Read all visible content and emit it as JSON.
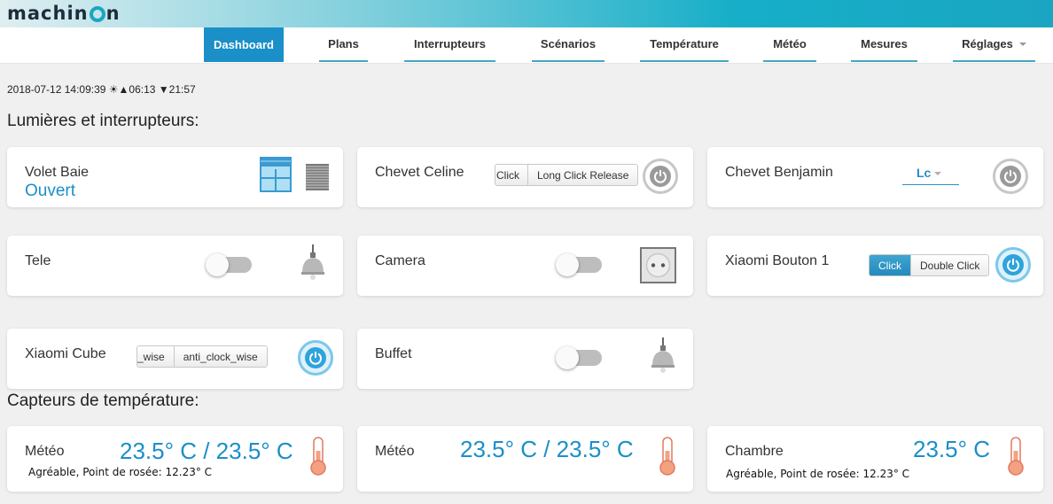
{
  "app": {
    "logo_text": "machinon"
  },
  "nav": {
    "items": [
      {
        "label": "Dashboard",
        "active": true
      },
      {
        "label": "Plans"
      },
      {
        "label": "Interrupteurs"
      },
      {
        "label": "Scénarios"
      },
      {
        "label": "Température"
      },
      {
        "label": "Météo"
      },
      {
        "label": "Mesures"
      },
      {
        "label": "Réglages",
        "has_caret": true
      }
    ]
  },
  "status_bar": {
    "datetime": "2018-07-12 14:09:39",
    "sunrise": "▲06:13",
    "sunset": "▼21:57",
    "sun_icon": "☀"
  },
  "lights_section": {
    "title": "Lumières et interrupteurs:",
    "devices": [
      {
        "name": "Volet Baie",
        "status": "Ouvert",
        "type": "blinds",
        "icons": [
          "blind-open-icon",
          "blind-closed-icon"
        ]
      },
      {
        "name": "Chevet Celine",
        "type": "selector",
        "buttons": [
          "Click",
          "Long Click Release"
        ],
        "power_state": "off"
      },
      {
        "name": "Chevet Benjamin",
        "type": "dropdown",
        "selected": "Lc",
        "power_state": "off"
      },
      {
        "name": "Tele",
        "type": "toggle",
        "state": "off",
        "icon": "lamp-icon"
      },
      {
        "name": "Camera",
        "type": "toggle",
        "state": "off",
        "icon": "socket-icon"
      },
      {
        "name": "Xiaomi Bouton 1",
        "type": "selector",
        "buttons": [
          "Click",
          "Double Click"
        ],
        "selected": "Click",
        "power_state": "on"
      },
      {
        "name": "Xiaomi Cube",
        "type": "selector",
        "buttons": [
          "_wise",
          "anti_clock_wise"
        ],
        "power_state": "on"
      },
      {
        "name": "Buffet",
        "type": "toggle",
        "state": "off",
        "icon": "lamp-icon"
      }
    ]
  },
  "temp_section": {
    "title": "Capteurs de température:",
    "sensors": [
      {
        "name": "Météo",
        "value": "23.5° C / 23.5° C",
        "details": "Agréable, Point de rosée: 12.23° C"
      },
      {
        "name": "Météo",
        "value": "23.5° C / 23.5° C",
        "details": ""
      },
      {
        "name": "Chambre",
        "value": "23.5° C",
        "details": "Agréable, Point de rosée: 12.23° C"
      }
    ]
  },
  "colors": {
    "accent": "#1a8fc8",
    "header_gradient_end": "#1aa6c3"
  }
}
